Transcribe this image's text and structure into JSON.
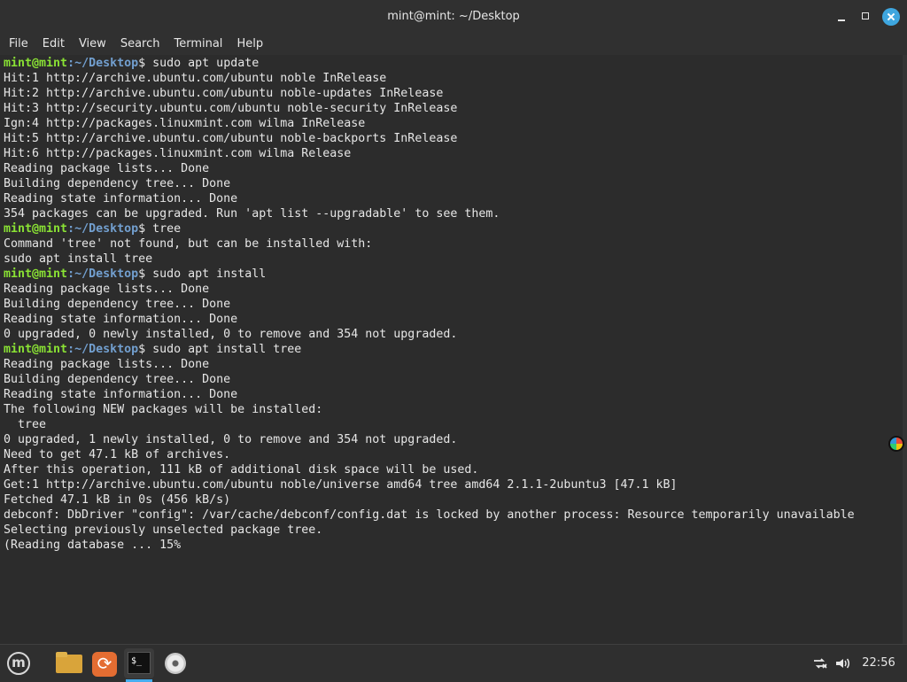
{
  "window": {
    "title": "mint@mint: ~/Desktop",
    "controls": [
      "minimize",
      "maximize",
      "close"
    ]
  },
  "menubar": {
    "items": [
      "File",
      "Edit",
      "View",
      "Search",
      "Terminal",
      "Help"
    ]
  },
  "terminal": {
    "prompt_user": "mint@mint",
    "prompt_path": ":~/Desktop",
    "prompt_symbol": "$",
    "lines": [
      {
        "type": "prompt",
        "command": "sudo apt update"
      },
      {
        "type": "output",
        "text": "Hit:1 http://archive.ubuntu.com/ubuntu noble InRelease"
      },
      {
        "type": "output",
        "text": "Hit:2 http://archive.ubuntu.com/ubuntu noble-updates InRelease"
      },
      {
        "type": "output",
        "text": "Hit:3 http://security.ubuntu.com/ubuntu noble-security InRelease"
      },
      {
        "type": "output",
        "text": "Ign:4 http://packages.linuxmint.com wilma InRelease"
      },
      {
        "type": "output",
        "text": "Hit:5 http://archive.ubuntu.com/ubuntu noble-backports InRelease"
      },
      {
        "type": "output",
        "text": "Hit:6 http://packages.linuxmint.com wilma Release"
      },
      {
        "type": "output",
        "text": "Reading package lists... Done"
      },
      {
        "type": "output",
        "text": "Building dependency tree... Done"
      },
      {
        "type": "output",
        "text": "Reading state information... Done"
      },
      {
        "type": "output",
        "text": "354 packages can be upgraded. Run 'apt list --upgradable' to see them."
      },
      {
        "type": "prompt",
        "command": "tree"
      },
      {
        "type": "output",
        "text": "Command 'tree' not found, but can be installed with:"
      },
      {
        "type": "output",
        "text": "sudo apt install tree"
      },
      {
        "type": "prompt",
        "command": "sudo apt install"
      },
      {
        "type": "output",
        "text": "Reading package lists... Done"
      },
      {
        "type": "output",
        "text": "Building dependency tree... Done"
      },
      {
        "type": "output",
        "text": "Reading state information... Done"
      },
      {
        "type": "output",
        "text": "0 upgraded, 0 newly installed, 0 to remove and 354 not upgraded."
      },
      {
        "type": "prompt",
        "command": "sudo apt install tree"
      },
      {
        "type": "output",
        "text": "Reading package lists... Done"
      },
      {
        "type": "output",
        "text": "Building dependency tree... Done"
      },
      {
        "type": "output",
        "text": "Reading state information... Done"
      },
      {
        "type": "output",
        "text": "The following NEW packages will be installed:"
      },
      {
        "type": "output",
        "text": "  tree"
      },
      {
        "type": "output",
        "text": "0 upgraded, 1 newly installed, 0 to remove and 354 not upgraded."
      },
      {
        "type": "output",
        "text": "Need to get 47.1 kB of archives."
      },
      {
        "type": "output",
        "text": "After this operation, 111 kB of additional disk space will be used."
      },
      {
        "type": "output",
        "text": "Get:1 http://archive.ubuntu.com/ubuntu noble/universe amd64 tree amd64 2.1.1-2ubuntu3 [47.1 kB]"
      },
      {
        "type": "output",
        "text": "Fetched 47.1 kB in 0s (456 kB/s)"
      },
      {
        "type": "output",
        "text": "debconf: DbDriver \"config\": /var/cache/debconf/config.dat is locked by another process: Resource temporarily unavailable"
      },
      {
        "type": "output",
        "text": "Selecting previously unselected package tree."
      },
      {
        "type": "output",
        "text": "(Reading database ... 15%"
      }
    ]
  },
  "taskbar": {
    "apps": [
      {
        "name": "menu-icon"
      },
      {
        "name": "files-icon"
      },
      {
        "name": "backup-icon"
      },
      {
        "name": "terminal-icon",
        "active": true
      },
      {
        "name": "disc-icon"
      }
    ],
    "tray": {
      "network_icon": "network-disconnected-icon",
      "volume_icon": "volume-icon",
      "clock": "22:56"
    },
    "accent_color": "#46aef0"
  }
}
